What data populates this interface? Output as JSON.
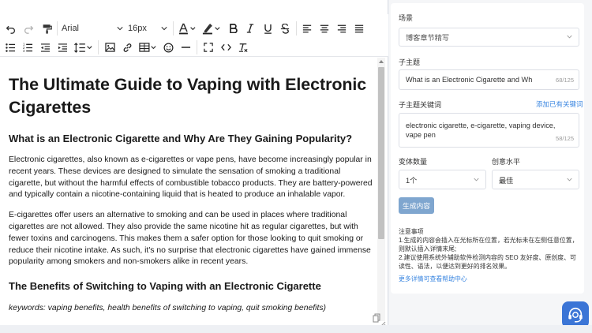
{
  "toolbar": {
    "font_family": "Arial",
    "font_size": "16px"
  },
  "document": {
    "title": "The Ultimate Guide to Vaping with Electronic Cigarettes",
    "sections": [
      {
        "heading": "What is an Electronic Cigarette and Why Are They Gaining Popularity?",
        "paragraphs": [
          "Electronic cigarettes, also known as e-cigarettes or vape pens, have become increasingly popular in recent years. These devices are designed to simulate the sensation of smoking a traditional cigarette, but without the harmful effects of combustible tobacco products. They are battery-powered and typically contain a nicotine-containing liquid that is heated to produce an inhalable vapor.",
          "E-cigarettes offer users an alternative to smoking and can be used in places where traditional cigarettes are not allowed. They also provide the same nicotine hit as regular cigarettes, but with fewer toxins and carcinogens. This makes them a safer option for those looking to quit smoking or reduce their nicotine intake. As such, it's no surprise that electronic cigarettes have gained immense popularity among smokers and non-smokers alike in recent years."
        ]
      },
      {
        "heading": "The Benefits of Switching to Vaping with an Electronic Cigarette",
        "keywords": "keywords: vaping benefits, health benefits of switching to vaping, quit smoking benefits)"
      }
    ]
  },
  "panel": {
    "scene_label": "场景",
    "scene_value": "博客章节精写",
    "subtopic_label": "子主题",
    "subtopic_value": "What is an Electronic Cigarette and Why Are T",
    "subtopic_count": "68/125",
    "keywords_label": "子主题关键词",
    "keywords_link": "添加已有关键词",
    "keywords_value": "electronic cigarette, e-cigarette, vaping device, vape pen",
    "keywords_count": "58/125",
    "variants_label": "变体数量",
    "variants_value": "1个",
    "creativity_label": "创意水平",
    "creativity_value": "最佳",
    "generate_button": "生成内容",
    "notes_title": "注意事项",
    "notes_line1": "1.生成的内容会插入在光标所在位置，若光标未在左侧任意位置，则默认插入详情末尾;",
    "notes_line2": "2.建议使用系统外辅助软件检测内容的 SEO 友好度、原创度、可读性、语法，以便达到更好的排名效果。",
    "help_link": "更多详情可查看帮助中心"
  },
  "colors": {
    "accent": "#3a86e0",
    "button": "#7fa6cf",
    "help": "#3b75d6"
  }
}
